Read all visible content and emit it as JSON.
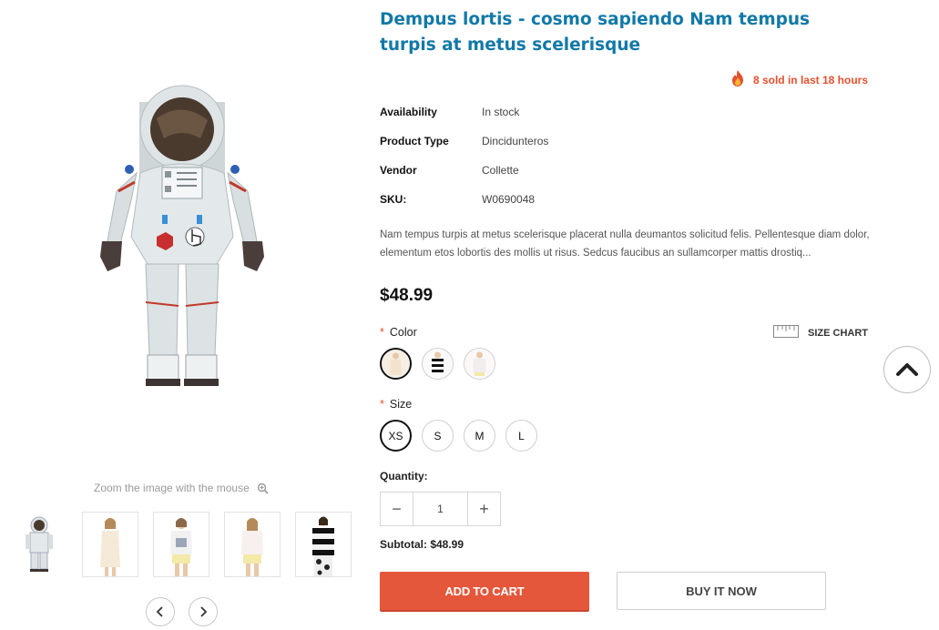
{
  "product": {
    "title": "Dempus lortis - cosmo sapiendo Nam tempus turpis at metus scelerisque",
    "sold_text": "8 sold in last 18 hours",
    "info": [
      {
        "key": "Availability",
        "value": "In stock"
      },
      {
        "key": "Product Type",
        "value": "Dincidunteros"
      },
      {
        "key": "Vendor",
        "value": "Collette"
      },
      {
        "key": "SKU:",
        "value": "W0690048"
      }
    ],
    "description": "Nam tempus turpis at metus scelerisque placerat nulla deumantos solicitud felis. Pellentesque diam dolor, elementum etos lobortis des mollis ut risus. Sedcus faucibus an sullamcorper mattis drostiq...",
    "price": "$48.99"
  },
  "gallery": {
    "zoom_hint": "Zoom the image with the mouse",
    "icons": {
      "zoom": "zoom-in-icon",
      "prev": "chevron-left-icon",
      "next": "chevron-right-icon"
    }
  },
  "options": {
    "required_mark": "*",
    "color_label": "Color",
    "size_chart_label": "SIZE CHART",
    "size_label": "Size",
    "sizes": [
      "XS",
      "S",
      "M",
      "L"
    ],
    "selected_size": "XS"
  },
  "quantity": {
    "label": "Quantity:",
    "minus": "−",
    "value": "1",
    "plus": "+",
    "subtotal": "Subtotal: $48.99"
  },
  "actions": {
    "add_to_cart": "ADD TO CART",
    "buy_now": "BUY IT NOW"
  },
  "colors": {
    "title": "#1179a8",
    "accent": "#e4573b",
    "sold": "#e4502e"
  }
}
